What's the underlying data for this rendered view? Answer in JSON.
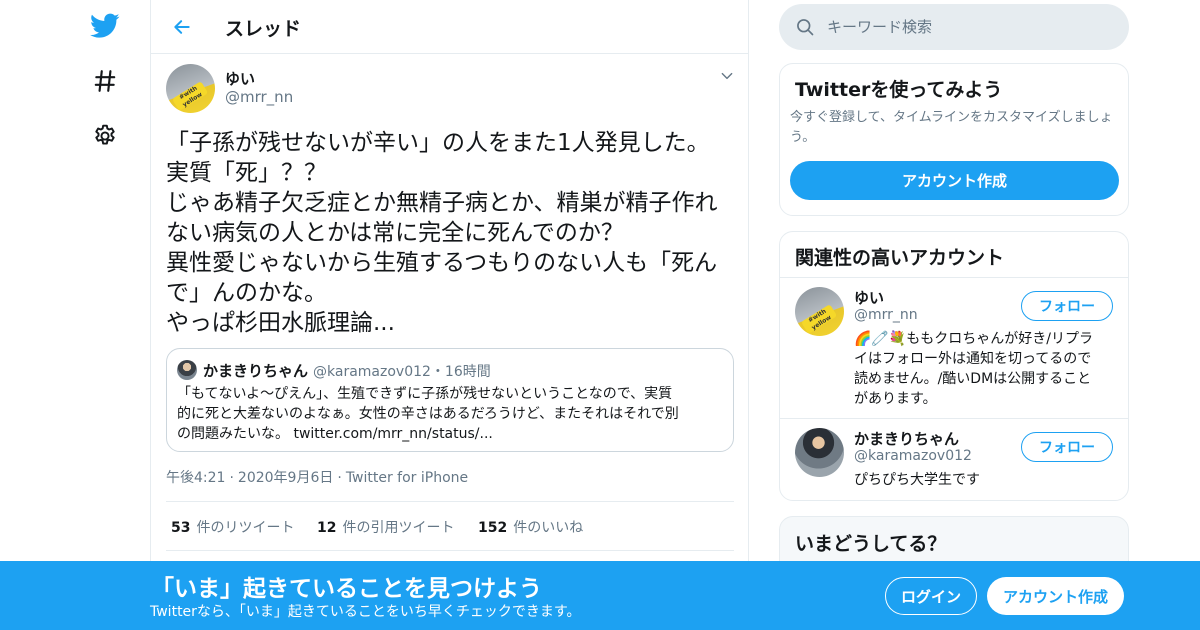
{
  "nav": {
    "icons": [
      "twitter-bird-icon",
      "hashtag-icon",
      "gear-icon"
    ]
  },
  "header": {
    "title": "スレッド"
  },
  "tweet": {
    "author_name": "ゆい",
    "author_handle": "@mrr_nn",
    "avatar_text": "#with yellow",
    "lines": [
      "「子孫が残せないが辛い」の人をまた1人発見した。",
      "実質「死」？？",
      "じゃあ精子欠乏症とか無精子病とか、精巣が精子作れ",
      "ない病気の人とかは常に完全に死んでのか？",
      "異性愛じゃないから生殖するつもりのない人も「死ん",
      "で」んのかな。",
      "やっぱ杉田水脈理論..."
    ],
    "quote": {
      "author_name": "かまきりちゃん",
      "author_handle": "@karamazov012・16時間",
      "lines": [
        "「もてないよ～ぴえん」、生殖できずに子孫が残せないということなので、実質",
        "的に死と大差ないのよなぁ。女性の辛さはあるだろうけど、またそれはそれで別",
        "の問題みたいな。 twitter.com/mrr_nn/status/..."
      ]
    },
    "time": "午後4:21",
    "date": "2020年9月6日",
    "source": "Twitter for iPhone",
    "separator": "·",
    "stats": {
      "retweets": "53",
      "retweets_label": "件のリツイート",
      "quotes": "12",
      "quotes_label": "件の引用ツイート",
      "likes": "152",
      "likes_label": "件のいいね"
    }
  },
  "search": {
    "placeholder": "キーワード検索"
  },
  "signup_card": {
    "title": "Twitterを使ってみよう",
    "desc": "今すぐ登録して、タイムラインをカスタマイズしましょう。",
    "button": "アカウント作成"
  },
  "related": {
    "title": "関連性の高いアカウント",
    "accounts": [
      {
        "name": "ゆい",
        "handle": "@mrr_nn",
        "bio": "🌈🧷💐ももクロちゃんが好き/リプライはフォロー外は通知を切ってるので読めません。/酷いDMは公開することがあります。",
        "follow": "フォロー"
      },
      {
        "name": "かまきりちゃん",
        "handle": "@karamazov012",
        "bio": "ぴちぴち大学生です",
        "follow": "フォロー"
      }
    ]
  },
  "now_card": {
    "title": "いまどうしてる？"
  },
  "banner": {
    "title": "「いま」起きていることを見つけよう",
    "subtitle": "Twitterなら、「いま」起きていることをいち早くチェックできます。",
    "login": "ログイン",
    "signup": "アカウント作成"
  },
  "colors": {
    "accent": "#1da1f2",
    "text": "#14171a",
    "secondary": "#657786",
    "border": "#e6ecf0"
  }
}
